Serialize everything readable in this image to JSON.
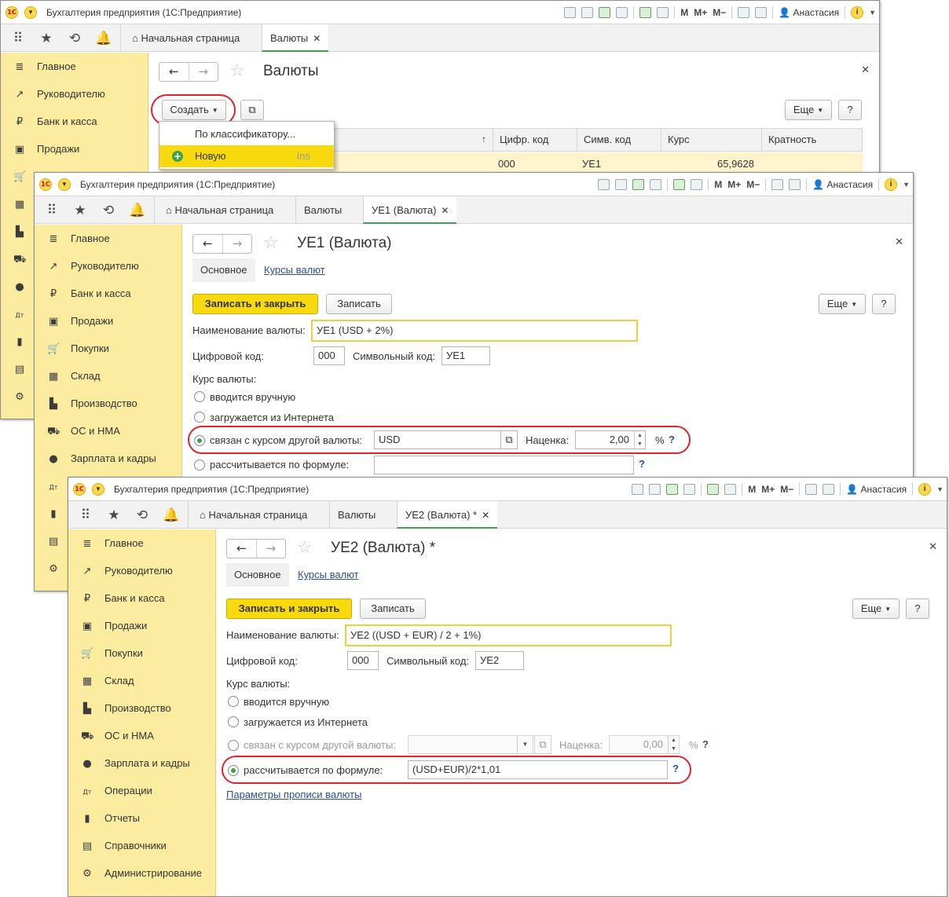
{
  "app_title": "Бухгалтерия предприятия   (1С:Предприятие)",
  "user_name": "Анастасия",
  "toolbar_marks": [
    "M",
    "M+",
    "M−"
  ],
  "tab_home": "Начальная страница",
  "sidebar_items": [
    {
      "label": "Главное",
      "icon": "list-icon"
    },
    {
      "label": "Руководителю",
      "icon": "trend-icon"
    },
    {
      "label": "Банк и касса",
      "icon": "ruble-icon"
    },
    {
      "label": "Продажи",
      "icon": "bag-icon"
    },
    {
      "label": "Покупки",
      "icon": "cart-icon"
    },
    {
      "label": "Склад",
      "icon": "warehouse-icon"
    },
    {
      "label": "Производство",
      "icon": "factory-icon"
    },
    {
      "label": "ОС и НМА",
      "icon": "truck-icon"
    },
    {
      "label": "Зарплата и кадры",
      "icon": "person-icon"
    },
    {
      "label": "Операции",
      "icon": "dt-kt-icon"
    },
    {
      "label": "Отчеты",
      "icon": "bar-chart-icon"
    },
    {
      "label": "Справочники",
      "icon": "books-icon"
    },
    {
      "label": "Администрирование",
      "icon": "gear-icon"
    }
  ],
  "w1": {
    "tab_currencies": "Валюты",
    "title": "Валюты",
    "create_btn": "Создать",
    "more_btn": "Еще",
    "help_btn": "?",
    "columns": [
      "Цифр. код",
      "Симв. код",
      "Курс",
      "Кратность"
    ],
    "row": {
      "code": "000",
      "symbol": "УЕ1",
      "rate": "65,9628"
    },
    "popup": {
      "item1": "По классификатору...",
      "item2": "Новую",
      "shortcut": "Ins"
    }
  },
  "w2": {
    "tab_currencies": "Валюты",
    "tab_form": "УЕ1 (Валюта)",
    "title": "УЕ1 (Валюта)",
    "subtab_main": "Основное",
    "subtab_rates": "Курсы валют",
    "save_close": "Записать и закрыть",
    "save": "Записать",
    "more_btn": "Еще",
    "help_btn": "?",
    "name_label": "Наименование валюты:",
    "name_value": "УЕ1 (USD + 2%)",
    "digit_label": "Цифровой код:",
    "digit_value": "000",
    "symbol_label": "Символьный код:",
    "symbol_value": "УЕ1",
    "rate_label": "Курс валюты:",
    "opt_manual": "вводится вручную",
    "opt_internet": "загружается из Интернета",
    "opt_linked": "связан с курсом другой валюты:",
    "linked_value": "USD",
    "markup_label": "Наценка:",
    "markup_value": "2,00",
    "percent": "%",
    "q": "?",
    "opt_formula": "рассчитывается по формуле:",
    "formula_value": ""
  },
  "w3": {
    "tab_currencies": "Валюты",
    "tab_form": "УЕ2 (Валюта) *",
    "title": "УЕ2 (Валюта) *",
    "subtab_main": "Основное",
    "subtab_rates": "Курсы валют",
    "save_close": "Записать и закрыть",
    "save": "Записать",
    "more_btn": "Еще",
    "help_btn": "?",
    "name_label": "Наименование валюты:",
    "name_value": "УЕ2 ((USD + EUR) / 2 + 1%)",
    "digit_label": "Цифровой код:",
    "digit_value": "000",
    "symbol_label": "Символьный код:",
    "symbol_value": "УЕ2",
    "rate_label": "Курс валюты:",
    "opt_manual": "вводится вручную",
    "opt_internet": "загружается из Интернета",
    "opt_linked": "связан с курсом другой валюты:",
    "linked_value": "",
    "markup_label": "Наценка:",
    "markup_value": "0,00",
    "percent": "%",
    "q": "?",
    "opt_formula": "рассчитывается по формуле:",
    "formula_value": "(USD+EUR)/2*1,01",
    "params_link": "Параметры прописи валюты"
  },
  "colors": {
    "sidebar": "#fbeca0",
    "accent_yellow": "#f8d90d",
    "highlight_red": "#e0222c",
    "link": "#2a4d9c"
  }
}
